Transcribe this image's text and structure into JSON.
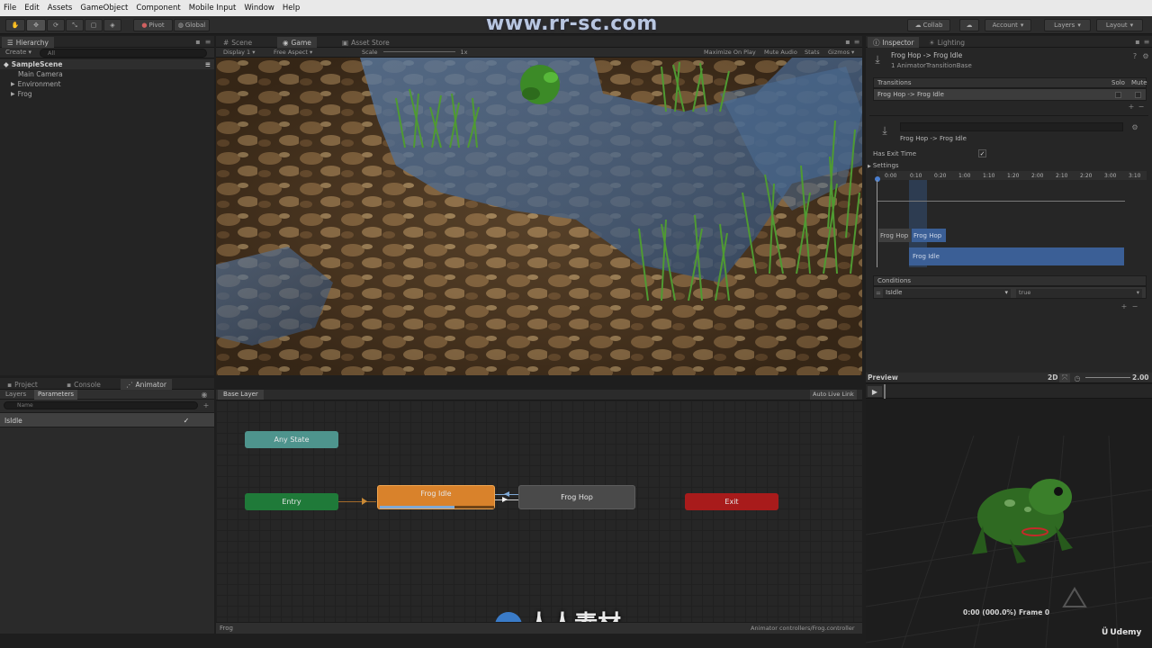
{
  "menu": [
    "File",
    "Edit",
    "Assets",
    "GameObject",
    "Component",
    "Mobile Input",
    "Window",
    "Help"
  ],
  "watermark": "www.rr-sc.com",
  "toolbar": {
    "pivot": "Pivot",
    "global": "Global",
    "collab": "Collab",
    "account": "Account",
    "layers": "Layers",
    "layout": "Layout"
  },
  "hierarchy": {
    "tab": "Hierarchy",
    "create": "Create",
    "search_placeholder": "All",
    "scene": "SampleScene",
    "items": [
      "Main Camera",
      "Environment",
      "Frog"
    ]
  },
  "scene_tabs": [
    "Scene",
    "Game",
    "Asset Store"
  ],
  "game_bar": {
    "display": "Display 1",
    "aspect": "Free Aspect",
    "scale_label": "Scale",
    "scale_value": "1x",
    "max_play": "Maximize On Play",
    "mute": "Mute Audio",
    "stats": "Stats",
    "gizmos": "Gizmos"
  },
  "inspector": {
    "tabs": [
      "Inspector",
      "Lighting"
    ],
    "title": "Frog Hop -> Frog Idle",
    "subtitle": "1 AnimatorTransitionBase",
    "transitions_header": "Transitions",
    "solo": "Solo",
    "mute": "Mute",
    "transition_item": "Frog Hop -> Frog Idle",
    "transition_name": "Frog Hop -> Frog Idle",
    "has_exit_time": "Has Exit Time",
    "settings": "Settings",
    "ticks": [
      "0:00",
      "0:10",
      "0:20",
      "1:00",
      "1:10",
      "1:20",
      "2:00",
      "2:10",
      "2:20",
      "3:00",
      "3:10"
    ],
    "clip_from": "Frog Hop",
    "clip_from2": "Frog Hop",
    "clip_to": "Frog Idle",
    "conditions_header": "Conditions",
    "condition_param": "IsIdle",
    "condition_value": "true"
  },
  "bottom_tabs": [
    "Project",
    "Console",
    "Animator"
  ],
  "animator": {
    "layers_tab": "Layers",
    "params_tab": "Parameters",
    "param_search": "Name",
    "param": "IsIdle",
    "base_layer": "Base Layer",
    "auto_live": "Auto Live Link",
    "nodes": {
      "any": "Any State",
      "entry": "Entry",
      "idle": "Frog Idle",
      "hop": "Frog Hop",
      "exit": "Exit"
    },
    "idle_progress": 0.65,
    "footer_left": "Frog",
    "footer_right": "Animator controllers/Frog.controller"
  },
  "preview": {
    "title": "Preview",
    "mode": "2D",
    "speed": "2.00",
    "time": "0:00 (000.0%) Frame 0"
  },
  "brand": {
    "udemy": "Udemy",
    "cn": "人人素材"
  },
  "colors": {
    "any": "#4e948d",
    "entry": "#1f7a39",
    "idle": "#d9822b",
    "hop": "#4a4a4a",
    "exit": "#a81b1b",
    "clip_to": "#3b5f96"
  }
}
